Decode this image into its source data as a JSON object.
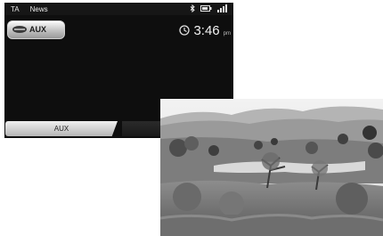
{
  "status": {
    "ta": "TA",
    "news": "News"
  },
  "source_button": {
    "label": "AUX"
  },
  "clock": {
    "time": "3:46",
    "ampm": "pm"
  },
  "tabs": [
    {
      "label": "AUX"
    },
    {
      "label": ""
    }
  ],
  "icons": [
    "bluetooth-icon",
    "battery-icon",
    "signal-icon",
    "clock-icon",
    "source-handle-icon"
  ],
  "colors": {
    "screen_bg": "#0e0e0e",
    "button_silver": "#bcbcbc",
    "text_light": "#f2f2f2"
  }
}
